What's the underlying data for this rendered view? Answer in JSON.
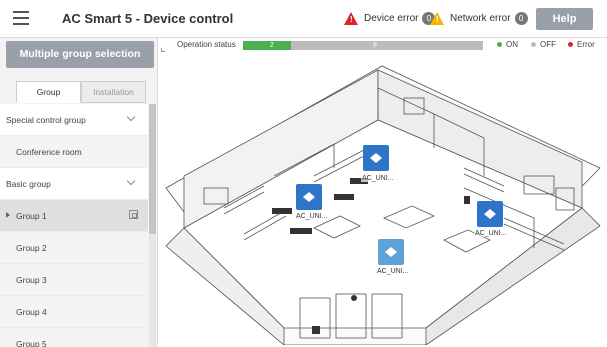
{
  "header": {
    "title": "AC Smart 5 - Device control",
    "device_error_label": "Device error",
    "device_error_count": "0",
    "network_error_label": "Network error",
    "network_error_count": "0",
    "help_label": "Help"
  },
  "sidebar": {
    "multi_select_label": "Multiple group selection",
    "tabs": [
      {
        "label": "Group",
        "active": true
      },
      {
        "label": "Installation",
        "active": false
      }
    ],
    "tree": {
      "special_group": "Special control group",
      "conference_room": "Conference room",
      "basic_group": "Basic group",
      "groups": [
        "Group 1",
        "Group 2",
        "Group 3",
        "Group 4",
        "Group 5"
      ]
    }
  },
  "status": {
    "label": "Operation status",
    "on_count": "2",
    "off_count": "8",
    "on_fraction": 0.2,
    "legend": {
      "on": "ON",
      "off": "OFF",
      "error": "Error"
    }
  },
  "units": [
    {
      "label": "AC_UNI..."
    },
    {
      "label": "AC_UNI..."
    },
    {
      "label": "AC_UNI..."
    },
    {
      "label": "AC_UNI..."
    }
  ],
  "colors": {
    "on": "#4caf50",
    "off": "#bcbcbc",
    "error": "#d9262c",
    "unit_active": "#2e75c9",
    "unit_idle": "#5ea3d8",
    "button": "#9aa0aa"
  }
}
